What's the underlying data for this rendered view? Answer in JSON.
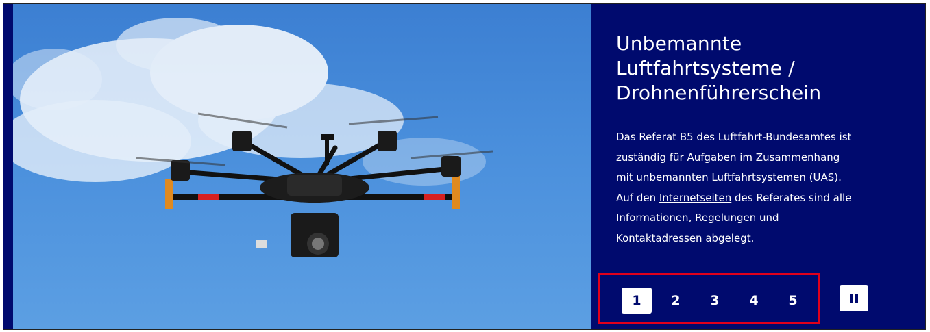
{
  "slide": {
    "title_line1": "Unbemannte",
    "title_line2": "Luftfahrtsysteme /",
    "title_line3": "Drohnenführerschein",
    "text_line1": "Das Referat B5 des Luftfahrt-Bundesamtes ist",
    "text_line2": "zuständig für Aufgaben im Zusammenhang",
    "text_line3": "mit unbemannten Luftfahrtsystemen (UAS).",
    "text_line4_pre": "Auf den",
    "link_label": "Internetseiten",
    "text_line4_post": "des Referates sind alle",
    "text_line5": "Informationen, Regelungen und",
    "text_line6": "Kontaktadressen abgelegt."
  },
  "pager": {
    "pages": [
      "1",
      "2",
      "3",
      "4",
      "5"
    ],
    "active_page": "1",
    "pause_icon": "pause-icon"
  },
  "image": {
    "subject": "hexacopter drone against blue sky with clouds"
  },
  "colors": {
    "panel_bg": "#000a6e",
    "highlight_border": "#e0001b",
    "sky": "#4a8fdc"
  }
}
